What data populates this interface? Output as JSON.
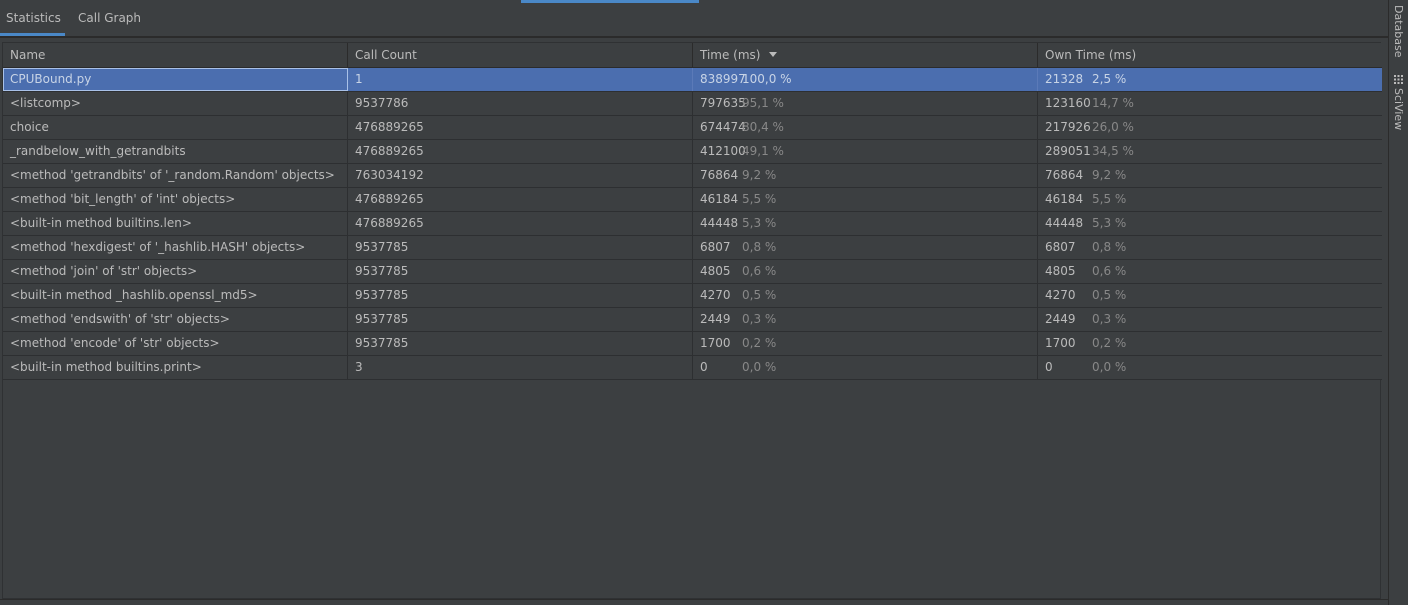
{
  "tabs": [
    {
      "label": "Statistics",
      "active": true
    },
    {
      "label": "Call Graph",
      "active": false
    }
  ],
  "side_tabs": {
    "database": "Database",
    "sciview": "SciView"
  },
  "columns": {
    "name": "Name",
    "call_count": "Call Count",
    "time": "Time (ms)",
    "own_time": "Own Time (ms)"
  },
  "sort": {
    "column": "time",
    "direction": "descending"
  },
  "rows": [
    {
      "name": "CPUBound.py",
      "count": "1",
      "time": "838997",
      "time_pct": "100,0 %",
      "own": "21328",
      "own_pct": "2,5 %",
      "selected": true
    },
    {
      "name": "<listcomp>",
      "count": "9537786",
      "time": "797635",
      "time_pct": "95,1 %",
      "own": "123160",
      "own_pct": "14,7 %"
    },
    {
      "name": "choice",
      "count": "476889265",
      "time": "674474",
      "time_pct": "80,4 %",
      "own": "217926",
      "own_pct": "26,0 %"
    },
    {
      "name": "_randbelow_with_getrandbits",
      "count": "476889265",
      "time": "412100",
      "time_pct": "49,1 %",
      "own": "289051",
      "own_pct": "34,5 %"
    },
    {
      "name": "<method 'getrandbits' of '_random.Random' objects>",
      "count": "763034192",
      "time": "76864",
      "time_pct": "9,2 %",
      "own": "76864",
      "own_pct": "9,2 %"
    },
    {
      "name": "<method 'bit_length' of 'int' objects>",
      "count": "476889265",
      "time": "46184",
      "time_pct": "5,5 %",
      "own": "46184",
      "own_pct": "5,5 %"
    },
    {
      "name": "<built-in method builtins.len>",
      "count": "476889265",
      "time": "44448",
      "time_pct": "5,3 %",
      "own": "44448",
      "own_pct": "5,3 %"
    },
    {
      "name": "<method 'hexdigest' of '_hashlib.HASH' objects>",
      "count": "9537785",
      "time": "6807",
      "time_pct": "0,8 %",
      "own": "6807",
      "own_pct": "0,8 %"
    },
    {
      "name": "<method 'join' of 'str' objects>",
      "count": "9537785",
      "time": "4805",
      "time_pct": "0,6 %",
      "own": "4805",
      "own_pct": "0,6 %"
    },
    {
      "name": "<built-in method _hashlib.openssl_md5>",
      "count": "9537785",
      "time": "4270",
      "time_pct": "0,5 %",
      "own": "4270",
      "own_pct": "0,5 %"
    },
    {
      "name": "<method 'endswith' of 'str' objects>",
      "count": "9537785",
      "time": "2449",
      "time_pct": "0,3 %",
      "own": "2449",
      "own_pct": "0,3 %"
    },
    {
      "name": "<method 'encode' of 'str' objects>",
      "count": "9537785",
      "time": "1700",
      "time_pct": "0,2 %",
      "own": "1700",
      "own_pct": "0,2 %"
    },
    {
      "name": "<built-in method builtins.print>",
      "count": "3",
      "time": "0",
      "time_pct": "0,0 %",
      "own": "0",
      "own_pct": "0,0 %"
    }
  ],
  "colors": {
    "background": "#3c3f41",
    "selection": "#4b6eaf",
    "accent": "#4a88c7",
    "text": "#bbbbbb",
    "muted_text": "#888888"
  }
}
